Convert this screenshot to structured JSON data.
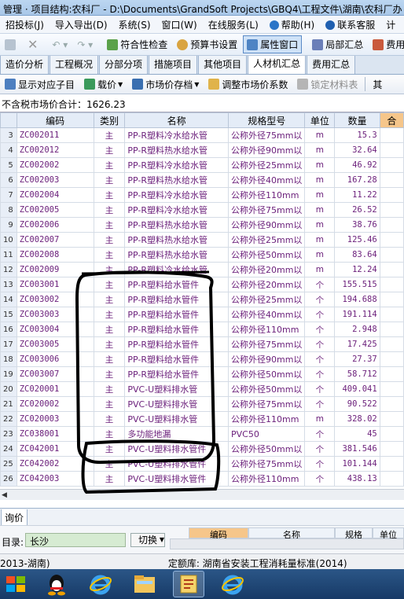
{
  "titlebar": {
    "text": "管理 · 项目结构:农科厂 - D:\\Documents\\GrandSoft Projects\\GBQ4\\工程文件\\湖南\\农科厂办"
  },
  "menu": {
    "items": [
      "招投标(J)",
      "导入导出(D)",
      "系统(S)",
      "窗口(W)",
      "在线服务(L)",
      "帮助(H)",
      "联系客服",
      "计"
    ]
  },
  "toolbar": {
    "check_label": "符合性检查",
    "budget_settings_label": "预算书设置",
    "property_window_label": "属性窗口",
    "local_summary_label": "局部汇总",
    "fee_label": "费用"
  },
  "tabs": [
    "造价分析",
    "工程概况",
    "分部分项",
    "措施项目",
    "其他项目",
    "人材机汇总",
    "费用汇总"
  ],
  "active_tab": "人材机汇总",
  "subtoolbar": {
    "show_item_label": "显示对应子目",
    "price_label": "载价",
    "market_price_label": "市场价存档",
    "adjust_coeff_label": "调整市场价系数",
    "lock_label": "锁定材料表",
    "more_label": "其"
  },
  "summary": {
    "text": "不含税市场价合计：1626.23"
  },
  "grid": {
    "columns": [
      "编码",
      "类别",
      "名称",
      "规格型号",
      "单位",
      "数量",
      "合"
    ],
    "rows": [
      {
        "n": "3",
        "code": "ZC002011",
        "cat": "主",
        "name": "PP-R塑料冷水给水管",
        "spec": "公称外径75mm以",
        "unit": "m",
        "qty": "15.3"
      },
      {
        "n": "4",
        "code": "ZC002012",
        "cat": "主",
        "name": "PP-R塑料热水给水管",
        "spec": "公称外径90mm以",
        "unit": "m",
        "qty": "32.64"
      },
      {
        "n": "5",
        "code": "ZC002002",
        "cat": "主",
        "name": "PP-R塑料冷水给水管",
        "spec": "公称外径25mm以",
        "unit": "m",
        "qty": "46.92"
      },
      {
        "n": "6",
        "code": "ZC002003",
        "cat": "主",
        "name": "PP-R塑料热水给水管",
        "spec": "公称外径40mm以",
        "unit": "m",
        "qty": "167.28"
      },
      {
        "n": "7",
        "code": "ZC002004",
        "cat": "主",
        "name": "PP-R塑料冷水给水管",
        "spec": "公称外径110mm",
        "unit": "m",
        "qty": "11.22"
      },
      {
        "n": "8",
        "code": "ZC002005",
        "cat": "主",
        "name": "PP-R塑料冷水给水管",
        "spec": "公称外径75mm以",
        "unit": "m",
        "qty": "26.52"
      },
      {
        "n": "9",
        "code": "ZC002006",
        "cat": "主",
        "name": "PP-R塑料热水给水管",
        "spec": "公称外径90mm以",
        "unit": "m",
        "qty": "38.76"
      },
      {
        "n": "10",
        "code": "ZC002007",
        "cat": "主",
        "name": "PP-R塑料热水给水管",
        "spec": "公称外径25mm以",
        "unit": "m",
        "qty": "125.46"
      },
      {
        "n": "11",
        "code": "ZC002008",
        "cat": "主",
        "name": "PP-R塑料热水给水管",
        "spec": "公称外径50mm以",
        "unit": "m",
        "qty": "83.64"
      },
      {
        "n": "12",
        "code": "ZC002009",
        "cat": "主",
        "name": "PP-R塑料冷水给水管",
        "spec": "公称外径20mm以",
        "unit": "m",
        "qty": "12.24"
      },
      {
        "n": "13",
        "code": "ZC003001",
        "cat": "主",
        "name": "PP-R塑料给水管件",
        "spec": "公称外径20mm以",
        "unit": "个",
        "qty": "155.515"
      },
      {
        "n": "14",
        "code": "ZC003002",
        "cat": "主",
        "name": "PP-R塑料给水管件",
        "spec": "公称外径25mm以",
        "unit": "个",
        "qty": "194.688"
      },
      {
        "n": "15",
        "code": "ZC003003",
        "cat": "主",
        "name": "PP-R塑料给水管件",
        "spec": "公称外径40mm以",
        "unit": "个",
        "qty": "191.114"
      },
      {
        "n": "16",
        "code": "ZC003004",
        "cat": "主",
        "name": "PP-R塑料给水管件",
        "spec": "公称外径110mm",
        "unit": "个",
        "qty": "2.948"
      },
      {
        "n": "17",
        "code": "ZC003005",
        "cat": "主",
        "name": "PP-R塑料给水管件",
        "spec": "公称外径75mm以",
        "unit": "个",
        "qty": "17.425"
      },
      {
        "n": "18",
        "code": "ZC003006",
        "cat": "主",
        "name": "PP-R塑料给水管件",
        "spec": "公称外径90mm以",
        "unit": "个",
        "qty": "27.37"
      },
      {
        "n": "19",
        "code": "ZC003007",
        "cat": "主",
        "name": "PP-R塑料给水管件",
        "spec": "公称外径50mm以",
        "unit": "个",
        "qty": "58.712"
      },
      {
        "n": "20",
        "code": "ZC020001",
        "cat": "主",
        "name": "PVC-U塑料排水管",
        "spec": "公称外径50mm以",
        "unit": "个",
        "qty": "409.041"
      },
      {
        "n": "21",
        "code": "ZC020002",
        "cat": "主",
        "name": "PVC-U塑料排水管",
        "spec": "公称外径75mm以",
        "unit": "个",
        "qty": "90.522"
      },
      {
        "n": "22",
        "code": "ZC020003",
        "cat": "主",
        "name": "PVC-U塑料排水管",
        "spec": "公称外径110mm",
        "unit": "m",
        "qty": "328.02"
      },
      {
        "n": "23",
        "code": "ZC038001",
        "cat": "主",
        "name": "多功能地漏",
        "spec": "PVC50",
        "unit": "个",
        "qty": "45"
      },
      {
        "n": "24",
        "code": "ZC042001",
        "cat": "主",
        "name": "PVC-U塑料排水管件",
        "spec": "公称外径50mm以",
        "unit": "个",
        "qty": "381.546"
      },
      {
        "n": "25",
        "code": "ZC042002",
        "cat": "主",
        "name": "PVC-U塑料排水管件",
        "spec": "公称外径75mm以",
        "unit": "个",
        "qty": "101.144"
      },
      {
        "n": "26",
        "code": "ZC042003",
        "cat": "主",
        "name": "PVC-U塑料排水管件",
        "spec": "公称外径110mm",
        "unit": "个",
        "qty": "438.13"
      }
    ]
  },
  "lower_pane": {
    "tab_label": "询价",
    "catalog_label": "目录:",
    "catalog_value": "长沙",
    "switch_label": "切换",
    "columns": [
      "编码",
      "名称",
      "规格",
      "单位"
    ]
  },
  "status": {
    "left": "2013-湖南)",
    "quota_label": "定额库: 湖南省安装工程消耗量标准(2014)"
  },
  "taskbar": {
    "items": [
      "start-icon",
      "qq-icon",
      "ie-icon",
      "explorer-icon",
      "app-icon",
      "ie-icon"
    ]
  }
}
